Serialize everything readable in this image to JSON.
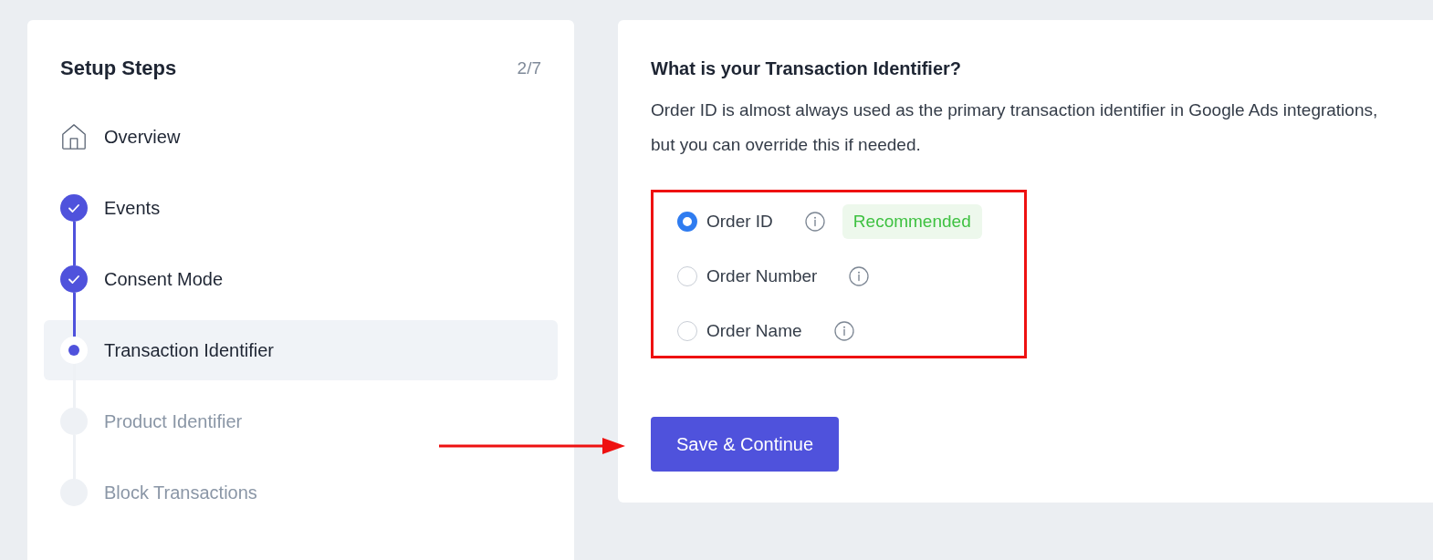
{
  "sidebar": {
    "title": "Setup Steps",
    "progress": "2/7",
    "steps": [
      {
        "label": "Overview",
        "kind": "home",
        "selected": false
      },
      {
        "label": "Events",
        "kind": "done",
        "selected": false
      },
      {
        "label": "Consent Mode",
        "kind": "done",
        "selected": false
      },
      {
        "label": "Transaction Identifier",
        "kind": "current",
        "selected": true
      },
      {
        "label": "Product Identifier",
        "kind": "pending",
        "selected": false
      },
      {
        "label": "Block Transactions",
        "kind": "pending",
        "selected": false
      }
    ]
  },
  "content": {
    "title": "What is your Transaction Identifier?",
    "description": "Order ID is almost always used as the primary transaction identifier in Google Ads integrations, but you can override this if needed.",
    "options": [
      {
        "label": "Order ID",
        "selected": true,
        "badge": "Recommended"
      },
      {
        "label": "Order Number",
        "selected": false
      },
      {
        "label": "Order Name",
        "selected": false
      }
    ],
    "button": "Save & Continue"
  }
}
